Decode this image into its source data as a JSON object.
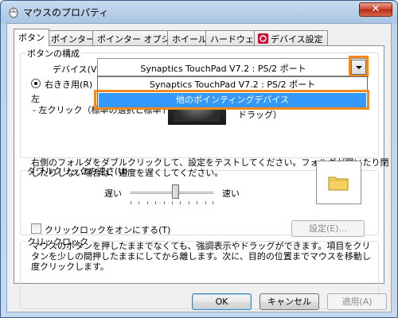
{
  "window": {
    "title": "マウスのプロパティ",
    "close_label": "✕"
  },
  "tabs": [
    {
      "label": "ボタン",
      "active": true
    },
    {
      "label": "ポインター"
    },
    {
      "label": "ポインター オプション"
    },
    {
      "label": "ホイール"
    },
    {
      "label": "ハードウェア"
    },
    {
      "label": "デバイス設定"
    }
  ],
  "button_config": {
    "group_label": "ボタンの構成",
    "device_label": "デバイス(V):",
    "device_value": "Synaptics TouchPad V7.2 : PS/2 ポート",
    "options": [
      "Synaptics TouchPad V7.2 : PS/2 ポート",
      "他のポインティングデバイス"
    ],
    "radio_right_label": "右きき用(R)",
    "left_heading": "左",
    "left_desc": "- 左クリック（標準の選択と標準ドラッグ）",
    "right_desc_line1": "- 右クリック（コンテキスト メニューと特殊",
    "right_desc_line2": "ドラッグ）"
  },
  "double_click": {
    "group_label": "ダブルクリックの速さ(U)",
    "desc_line1": "右側のフォルダをダブルクリックして、設定をテストしてください。フォルダが開いたり閉",
    "desc_line2": "じたりしない場合は、速度を遅くしてください。",
    "slow_label": "遅い",
    "fast_label": "速い",
    "speed_level": 0.5
  },
  "click_lock": {
    "group_label": "クリックロック",
    "checkbox_label": "クリックロックをオンにする(T)",
    "checked": false,
    "settings_button": "設定(E)...",
    "desc_line1": "マウスのボタンを押したままでなくても、強調表示やドラッグができます。項目をクリックし、マウスのボ",
    "desc_line2": "タンを少しの間押したままにしてから離します。次に、目的の位置までマウスを移動し、そこでもう一",
    "desc_line3": "度クリックします。"
  },
  "footer": {
    "ok": "OK",
    "cancel": "キャンセル",
    "apply": "適用(A)"
  },
  "colors": {
    "highlight": "#f28a1c",
    "selection": "#3399ff"
  }
}
